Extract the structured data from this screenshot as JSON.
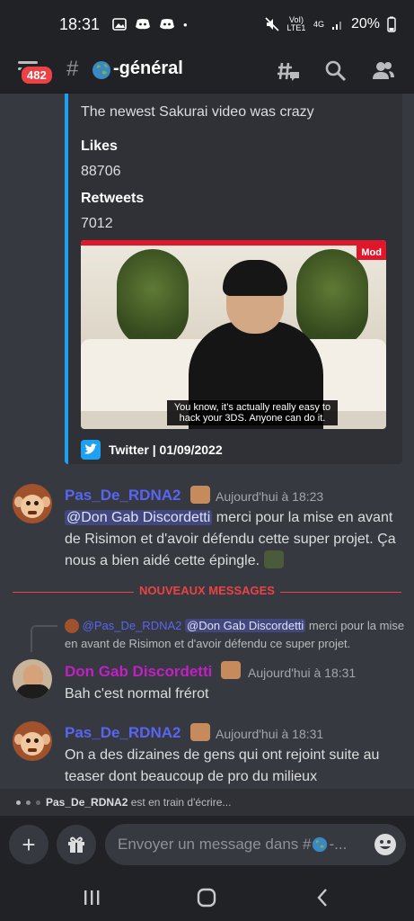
{
  "status_bar": {
    "time": "18:31",
    "dot": "•",
    "volte": "VoI) LTE1",
    "network": "4G",
    "battery": "20%"
  },
  "header": {
    "unread_badge": "482",
    "hash": "#",
    "channel_name": "-général"
  },
  "embed": {
    "tweet_text": "The newest Sakurai video was crazy",
    "likes_label": "Likes",
    "likes_value": "88706",
    "retweets_label": "Retweets",
    "retweets_value": "7012",
    "video_subtitle": "You know, it’s actually really easy to hack your 3DS. Anyone can do it.",
    "video_logo": "Mod",
    "footer": "Twitter | 01/09/2022",
    "accent_color": "#1da1f2"
  },
  "messages": [
    {
      "author": "Pas_De_RDNA2",
      "author_color": "#5865f2",
      "time": "Aujourd'hui à 18:23",
      "mention": "@Don Gab Discordetti",
      "text": " merci pour la mise en avant de Risimon et d'avoir défendu cette super projet. Ça nous a bien aidé cette épingle."
    },
    {
      "author": "Don Gab Discordetti",
      "author_color": "#c21fc4",
      "time": "Aujourd'hui à 18:31",
      "reply_author": "@Pas_De_RDNA2",
      "reply_mention": "@Don Gab Discordetti",
      "reply_text": " merci pour la mise en avant de Risimon et d'avoir défendu ce super projet.",
      "text": "Bah c'est normal frérot"
    },
    {
      "author": "Pas_De_RDNA2",
      "author_color": "#5865f2",
      "time": "Aujourd'hui à 18:31",
      "text": "On a des dizaines de gens qui ont rejoint suite au teaser dont beaucoup de pro du milieux"
    }
  ],
  "new_messages_label": "NOUVEAUX MESSAGES",
  "typing": {
    "user": "Pas_De_RDNA2",
    "text": " est en train d'écrire..."
  },
  "composer": {
    "placeholder": "Envoyer un message dans #",
    "ellipsis": "-...",
    "plus": "+"
  },
  "icons": {
    "menu": "hamburger-icon",
    "threads": "threads-icon",
    "search": "search-icon",
    "members": "members-icon",
    "gift": "gift-icon",
    "emoji": "emoji-icon",
    "nav_recent": "recent-apps-icon",
    "nav_home": "home-icon",
    "nav_back": "back-icon"
  }
}
